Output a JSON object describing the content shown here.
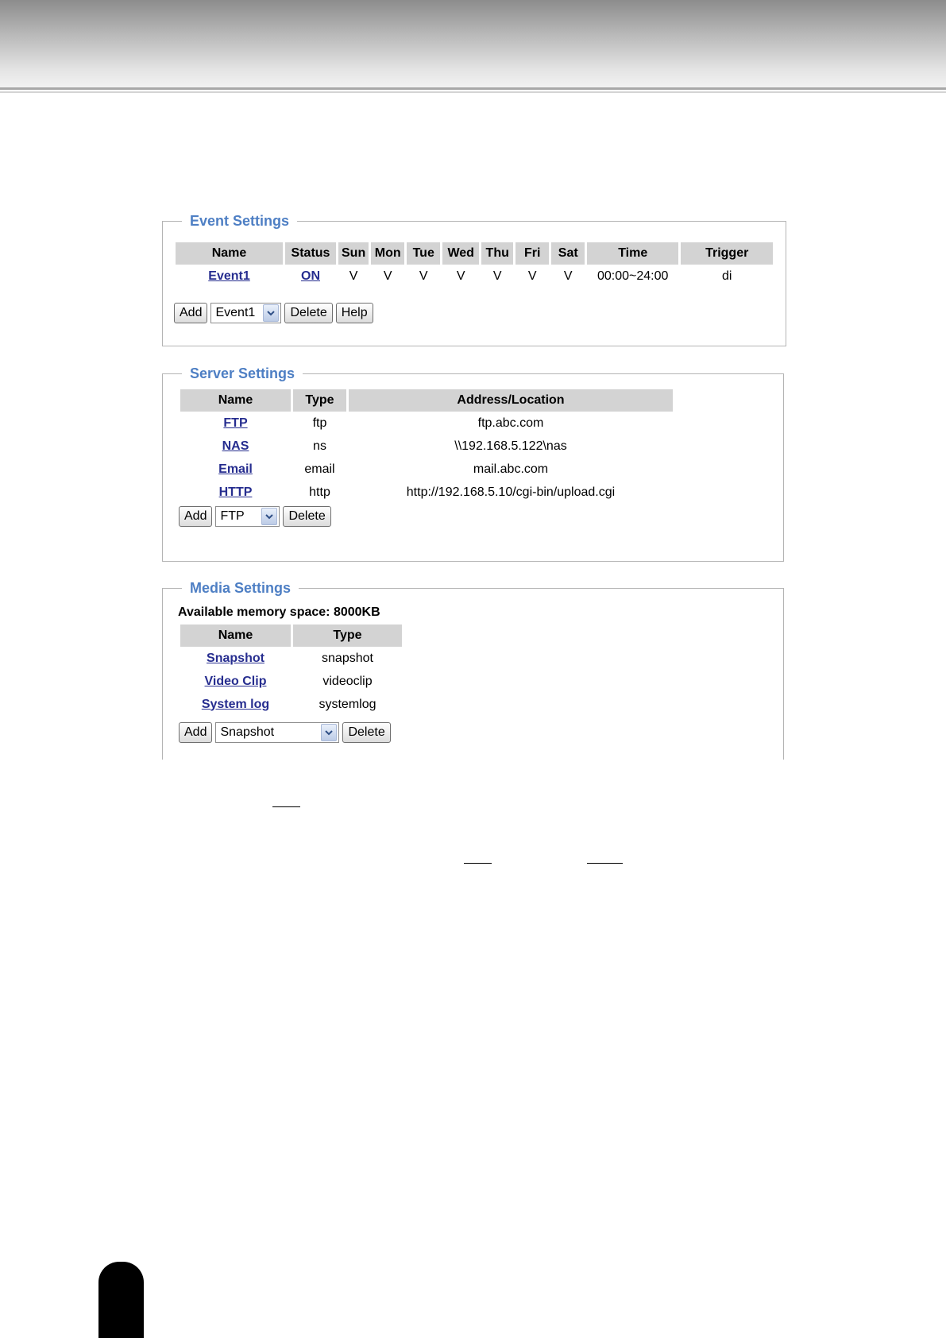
{
  "event_settings": {
    "legend": "Event Settings",
    "columns": [
      "Name",
      "Status",
      "Sun",
      "Mon",
      "Tue",
      "Wed",
      "Thu",
      "Fri",
      "Sat",
      "Time",
      "Trigger"
    ],
    "rows": [
      {
        "name": "Event1",
        "status": "ON",
        "sun": "V",
        "mon": "V",
        "tue": "V",
        "wed": "V",
        "thu": "V",
        "fri": "V",
        "sat": "V",
        "time": "00:00~24:00",
        "trigger": "di"
      }
    ],
    "add_label": "Add",
    "select_value": "Event1",
    "delete_label": "Delete",
    "help_label": "Help"
  },
  "server_settings": {
    "legend": "Server Settings",
    "columns": [
      "Name",
      "Type",
      "Address/Location"
    ],
    "rows": [
      {
        "name": "FTP",
        "type": "ftp",
        "address": "ftp.abc.com"
      },
      {
        "name": "NAS",
        "type": "ns",
        "address": "\\\\192.168.5.122\\nas"
      },
      {
        "name": "Email",
        "type": "email",
        "address": "mail.abc.com"
      },
      {
        "name": "HTTP",
        "type": "http",
        "address": "http://192.168.5.10/cgi-bin/upload.cgi"
      }
    ],
    "add_label": "Add",
    "select_value": "FTP",
    "delete_label": "Delete"
  },
  "media_settings": {
    "legend": "Media Settings",
    "memory_label": "Available memory space: 8000KB",
    "columns": [
      "Name",
      "Type"
    ],
    "rows": [
      {
        "name": "Snapshot",
        "type": "snapshot"
      },
      {
        "name": "Video Clip",
        "type": "videoclip"
      },
      {
        "name": "System log",
        "type": "systemlog"
      }
    ],
    "add_label": "Add",
    "select_value": "Snapshot",
    "delete_label": "Delete"
  },
  "icons": {
    "dropdown": "chevron-down-icon"
  },
  "colors": {
    "legend": "#4e7fc4",
    "link": "#262d8f",
    "header_bg": "#d3d3d3"
  }
}
